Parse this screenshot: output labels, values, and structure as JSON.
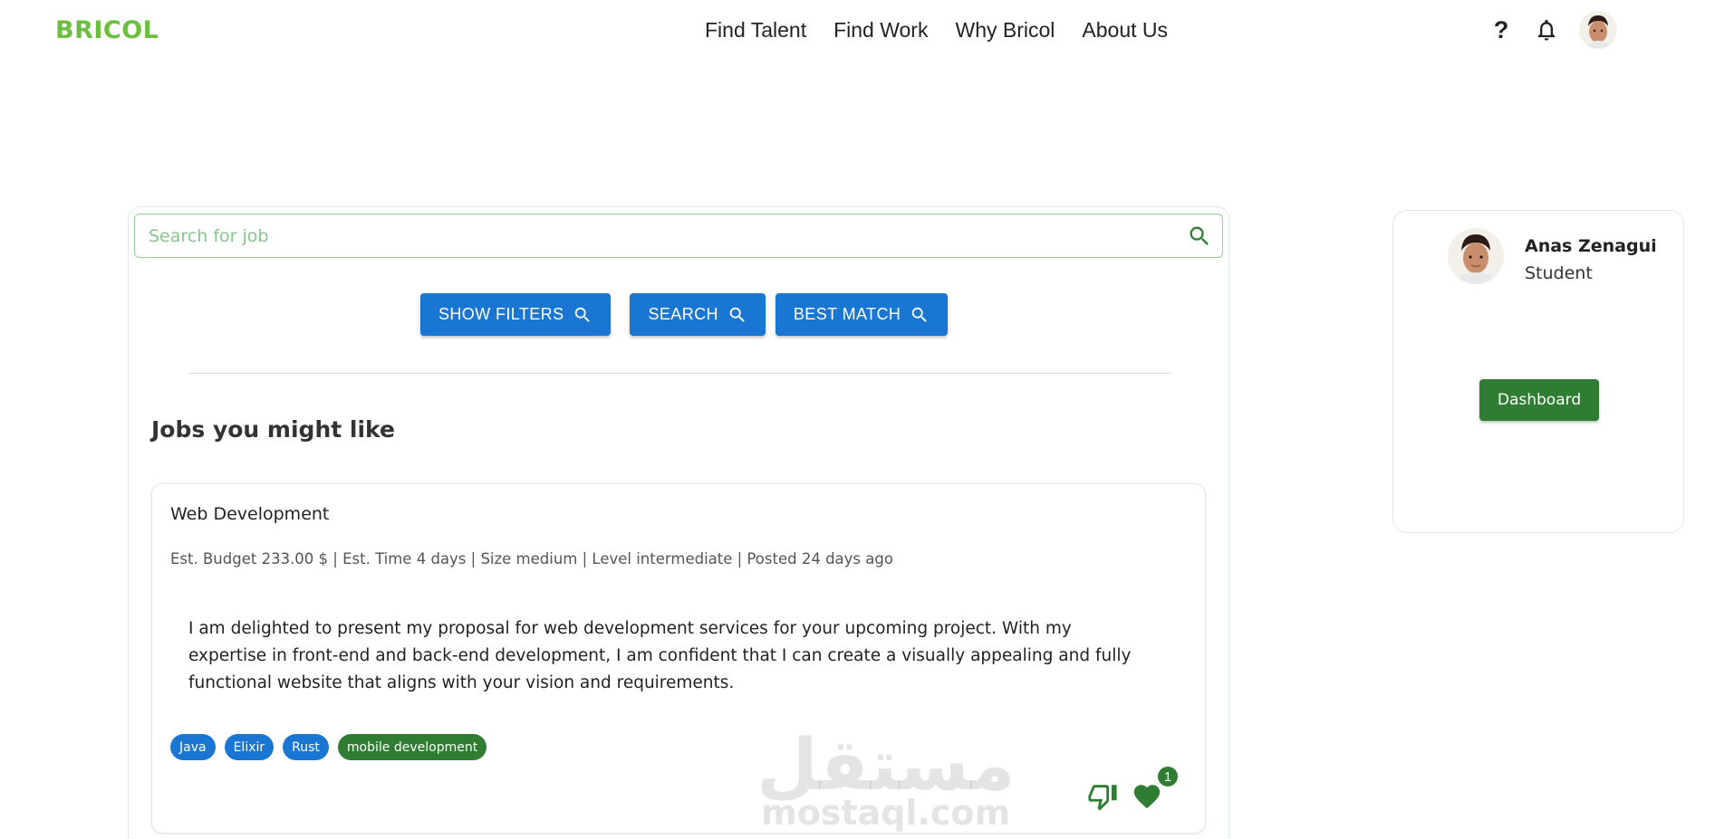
{
  "header": {
    "logo": "BRICOL",
    "nav": [
      "Find Talent",
      "Find Work",
      "Why Bricol",
      "About Us"
    ],
    "help_icon": "question-mark-icon",
    "bell_icon": "bell-icon"
  },
  "search": {
    "placeholder": "Search for job",
    "value": ""
  },
  "buttons": {
    "show_filters": "SHOW FILTERS",
    "search": "SEARCH",
    "best_match": "BEST MATCH"
  },
  "section_title": "Jobs you might like",
  "job": {
    "title": "Web Development",
    "meta": "Est. Budget 233.00 $ | Est. Time 4 days | Size medium | Level intermediate | Posted 24 days ago",
    "description": "I am delighted to present my proposal for web development services for your upcoming project. With my expertise in front-end and back-end development, I am confident that I can create a visually appealing and fully functional website that aligns with your vision and requirements.",
    "tags": [
      {
        "label": "Java",
        "color": "#1976d2"
      },
      {
        "label": "Elixir",
        "color": "#1976d2"
      },
      {
        "label": "Rust",
        "color": "#1976d2"
      },
      {
        "label": "mobile development",
        "color": "#2e7d32"
      }
    ],
    "likes": "1"
  },
  "watermark": {
    "arabic": "مستقل",
    "latin": "mostaql.com"
  },
  "profile": {
    "name": "Anas Zenagui",
    "role": "Student",
    "dashboard_label": "Dashboard"
  },
  "colors": {
    "brand_green": "#6cbf3e",
    "primary_blue": "#1976d2",
    "dark_green": "#2e7d32"
  }
}
